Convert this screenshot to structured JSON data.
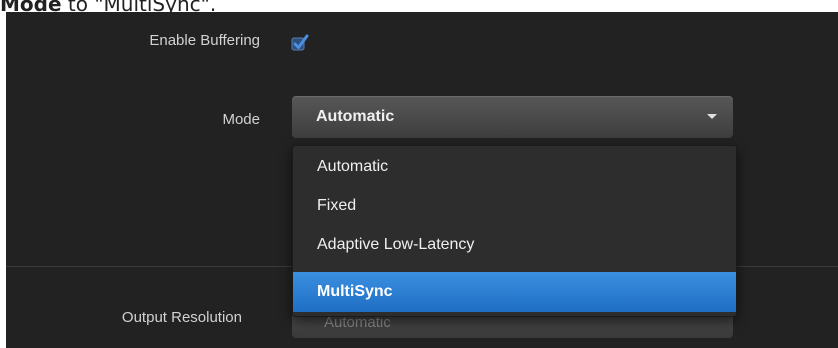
{
  "caption": {
    "bold": "Mode",
    "rest": " to \"MultiSync\"."
  },
  "enable_buffering": {
    "label": "Enable Buffering",
    "checked": true,
    "check_color": "#4a8fe0"
  },
  "mode": {
    "label": "Mode",
    "selected": "Automatic",
    "options": [
      "Automatic",
      "Fixed",
      "Adaptive Low-Latency",
      "MultiSync"
    ],
    "highlighted": "MultiSync",
    "highlight_color": "#2a7fd6"
  },
  "output_resolution": {
    "label": "Output Resolution",
    "value": "Automatic"
  }
}
